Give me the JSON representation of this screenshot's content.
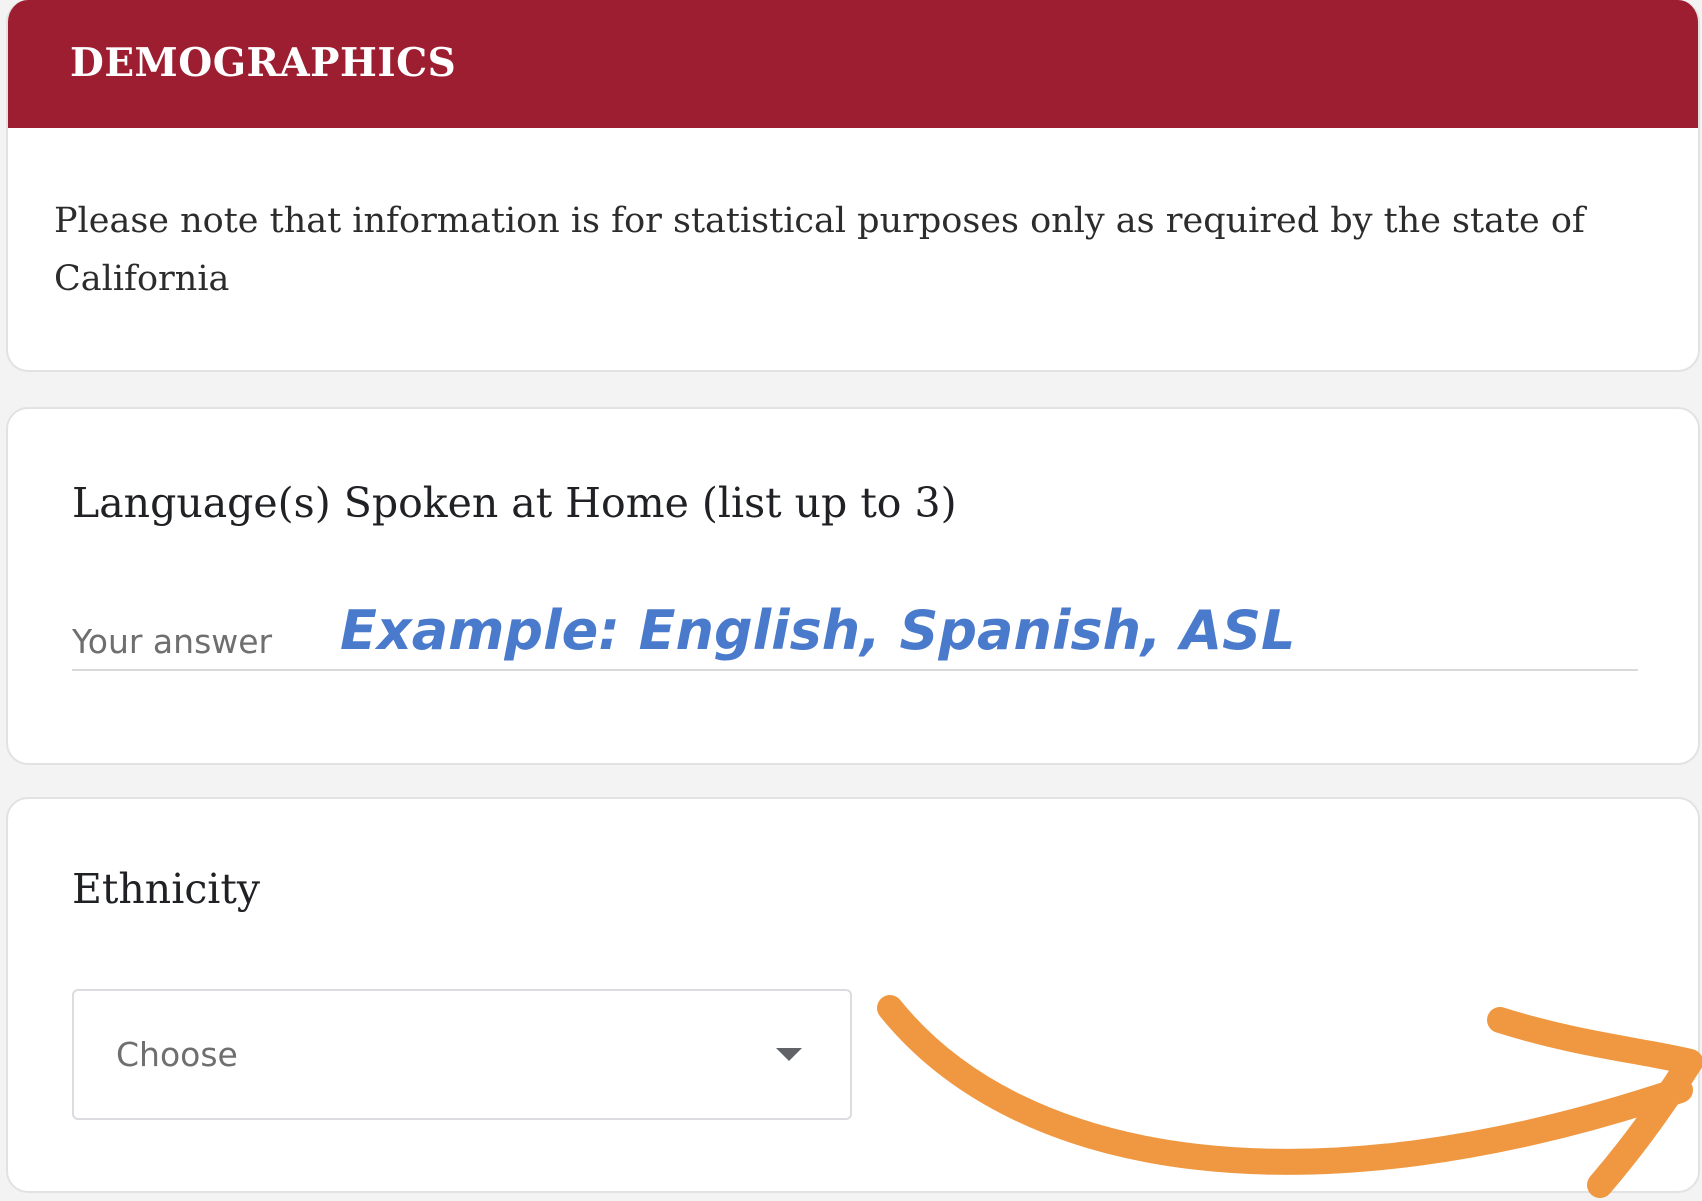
{
  "header": {
    "title": "DEMOGRAPHICS",
    "note": "Please note that information is for statistical purposes only as required by the state of California",
    "color": "#9e1e31"
  },
  "language_question": {
    "title": "Language(s) Spoken at Home (list up to 3)",
    "placeholder": "Your answer",
    "example": "Example: English, Spanish, ASL",
    "example_color": "#4a7acb"
  },
  "ethnicity_question": {
    "title": "Ethnicity",
    "select_value": "Choose",
    "select_icon": "caret-down-icon"
  },
  "annotation": {
    "icon": "curved-arrow-icon",
    "color": "#ef9841"
  }
}
